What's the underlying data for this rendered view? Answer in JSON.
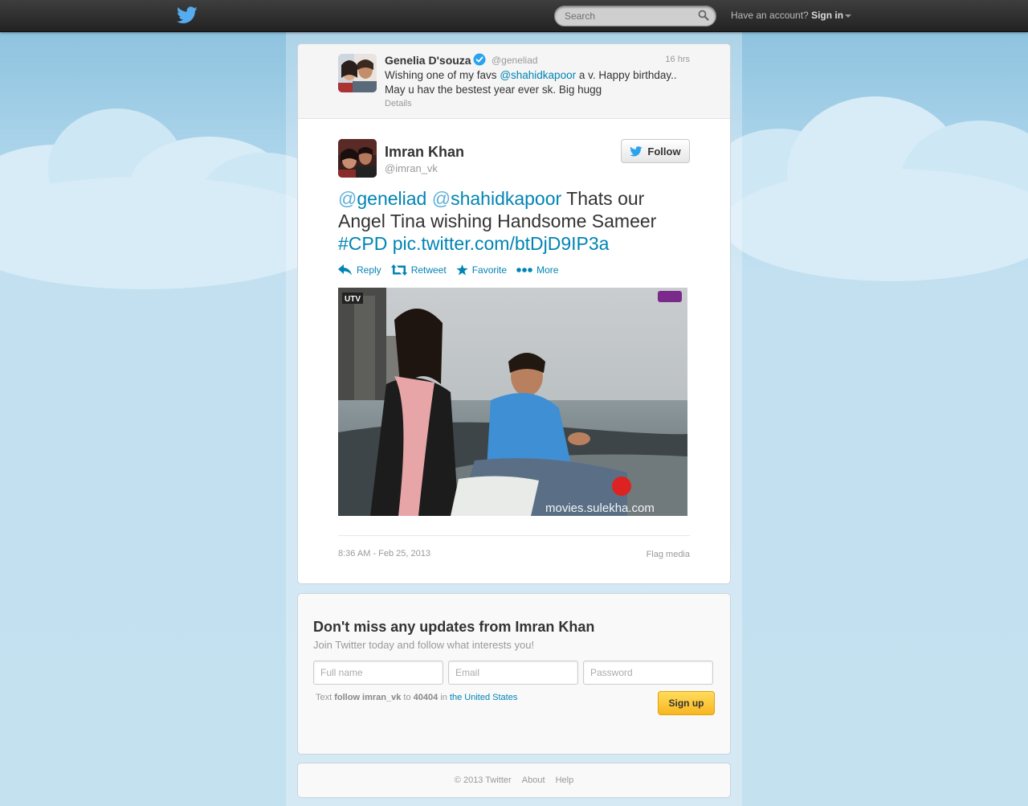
{
  "header": {
    "search_placeholder": "Search",
    "account_prompt": "Have an account?",
    "signin_label": "Sign in"
  },
  "parent_tweet": {
    "name": "Genelia D'souza",
    "handle": "@geneliad",
    "time": "16 hrs",
    "text_before": "Wishing one of my favs ",
    "mention": "@shahidkapoor",
    "text_after": " a v. Happy birthday.. May u hav the bestest year ever sk. Big hugg",
    "details_label": "Details"
  },
  "tweet": {
    "author_name": "Imran Khan",
    "author_handle": "@imran_vk",
    "follow_label": "Follow",
    "mention1_at": "@",
    "mention1": "geneliad",
    "mention2_at": "@",
    "mention2": "shahidkapoor",
    "text_middle": " Thats our Angel Tina wishing Handsome Sameer ",
    "hashtag": "#CPD",
    "link": "pic.twitter.com/btDjD9IP3a",
    "actions": {
      "reply": "Reply",
      "retweet": "Retweet",
      "favorite": "Favorite",
      "more": "More"
    },
    "media_watermark": "movies.sulekha.com",
    "media_logo": "UTV",
    "timestamp": "8:36 AM - Feb 25, 2013",
    "flag_label": "Flag media"
  },
  "signup": {
    "title": "Don't miss any updates from Imran Khan",
    "subtitle": "Join Twitter today and follow what interests you!",
    "fullname_placeholder": "Full name",
    "email_placeholder": "Email",
    "password_placeholder": "Password",
    "text_prefix": "Text ",
    "sms_command": "follow imran_vk",
    "text_to": " to ",
    "sms_number": "40404",
    "text_in": " in ",
    "country_link": "the United States",
    "signup_label": "Sign up"
  },
  "footer": {
    "copyright": "© 2013 Twitter",
    "about": "About",
    "help": "Help"
  },
  "colors": {
    "link": "#0084b4",
    "topbar": "#2b2b2b",
    "background": "#c0deed",
    "signup_button": "#f9c02c"
  }
}
